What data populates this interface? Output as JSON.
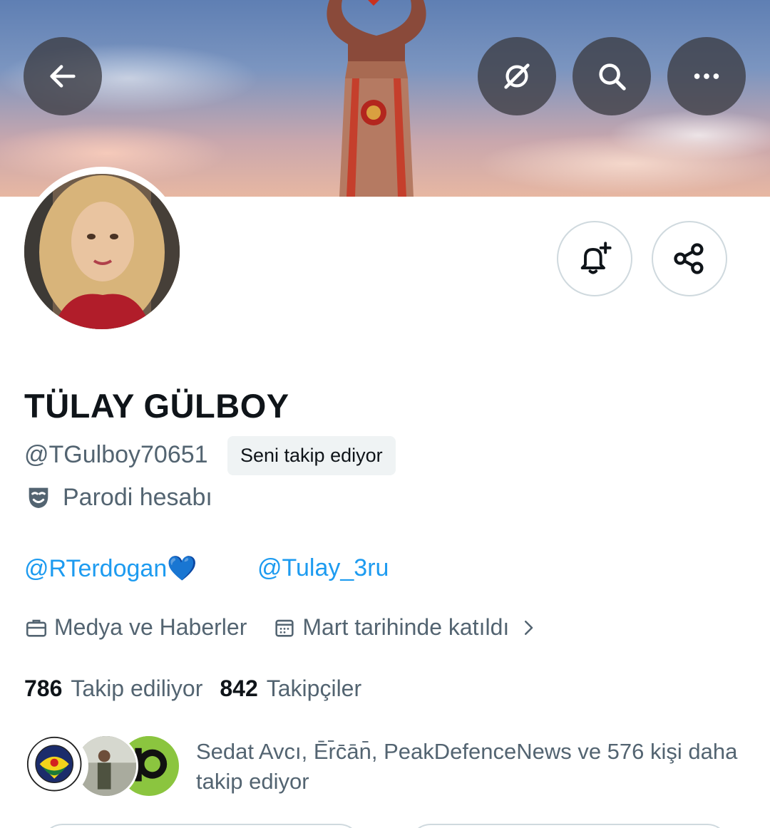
{
  "profile": {
    "display_name": "TÜLAY GÜLBOY",
    "handle": "@TGulboy70651",
    "follows_you_badge": "Seni takip ediyor",
    "parody_label": "Parodi hesabı",
    "bio_links": [
      "@RTerdogan💙",
      "@Tulay_3ru"
    ],
    "category": "Medya ve Haberler",
    "joined": "Mart tarihinde katıldı",
    "following_count": "786",
    "following_label": "Takip ediliyor",
    "followers_count": "842",
    "followers_label": "Takipçiler",
    "followers_you_know": "Sedat Avcı, Ēr̄c̄ān̄, PeakDefenceNews ve 576 kişi daha takip ediyor"
  },
  "header_buttons": {
    "back": "arrow-left-icon",
    "grok": "grok-icon",
    "search": "search-icon",
    "more": "more-icon"
  },
  "profile_buttons": {
    "notify": "bell-plus-icon",
    "share": "share-icon"
  },
  "colors": {
    "link": "#1d9bf0",
    "secondary_text": "#536471",
    "primary_text": "#0f1419"
  }
}
